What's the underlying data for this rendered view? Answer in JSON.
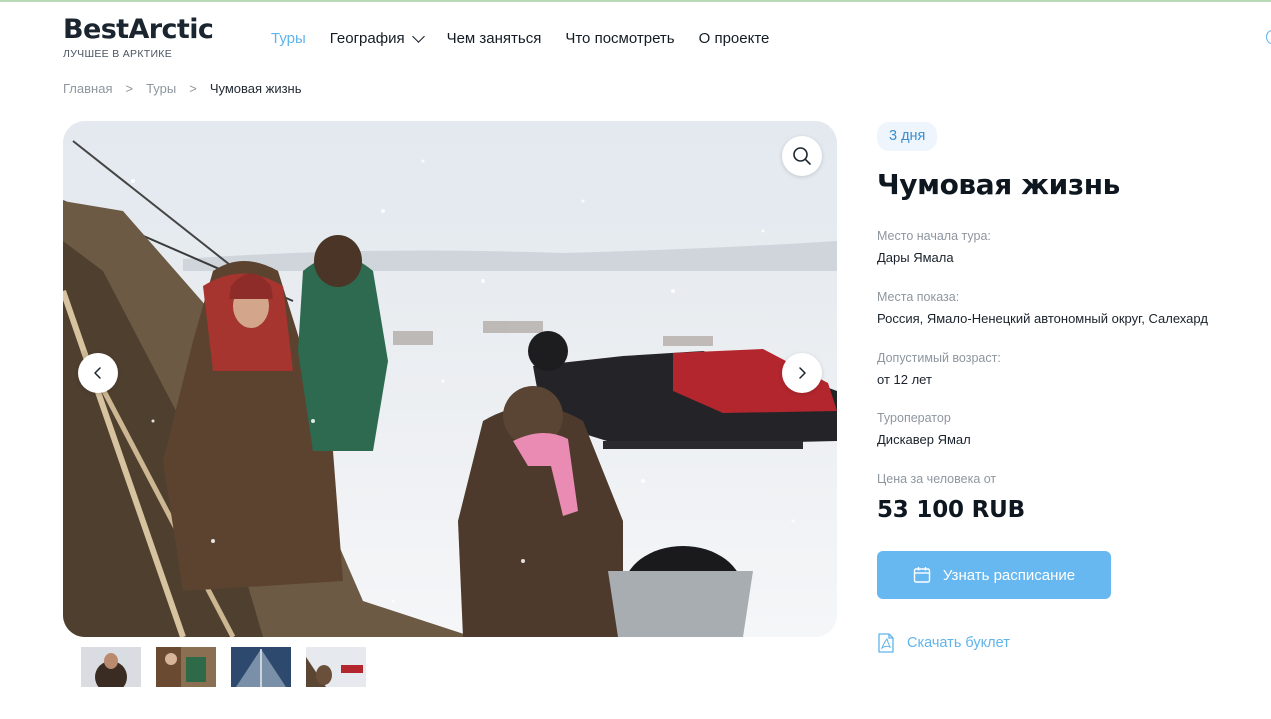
{
  "brand": {
    "name": "BestArctic",
    "tagline": "ЛУЧШЕЕ В АРКТИКЕ"
  },
  "nav": {
    "items": [
      {
        "label": "Туры",
        "active": true
      },
      {
        "label": "География",
        "has_dropdown": true
      },
      {
        "label": "Чем заняться"
      },
      {
        "label": "Что посмотреть"
      },
      {
        "label": "О проекте"
      }
    ]
  },
  "breadcrumb": {
    "items": [
      "Главная",
      "Туры"
    ],
    "separator": ">",
    "current": "Чумовая жизнь"
  },
  "gallery": {
    "icons": {
      "zoom": "search-icon",
      "prev": "chevron-left-icon",
      "next": "chevron-right-icon"
    },
    "thumbnail_count": 4
  },
  "tour": {
    "duration_badge": "3 дня",
    "title": "Чумовая жизнь",
    "fields": [
      {
        "label": "Место начала тура:",
        "value": "Дары Ямала"
      },
      {
        "label": "Места показа:",
        "value": "Россия, Ямало-Ненецкий автономный округ, Салехард"
      },
      {
        "label": "Допустимый возраст:",
        "value": "от 12 лет"
      },
      {
        "label": "Туроператор",
        "value": "Дискавер Ямал"
      }
    ],
    "price_label": "Цена за человека от",
    "price": "53 100 RUB",
    "schedule_button": "Узнать расписание",
    "download_link": "Скачать буклет"
  },
  "colors": {
    "accent": "#5fb4ec",
    "button": "#67b7f0",
    "badge_bg": "#eef5fc",
    "text": "#0e1620",
    "muted": "#8e969f"
  }
}
